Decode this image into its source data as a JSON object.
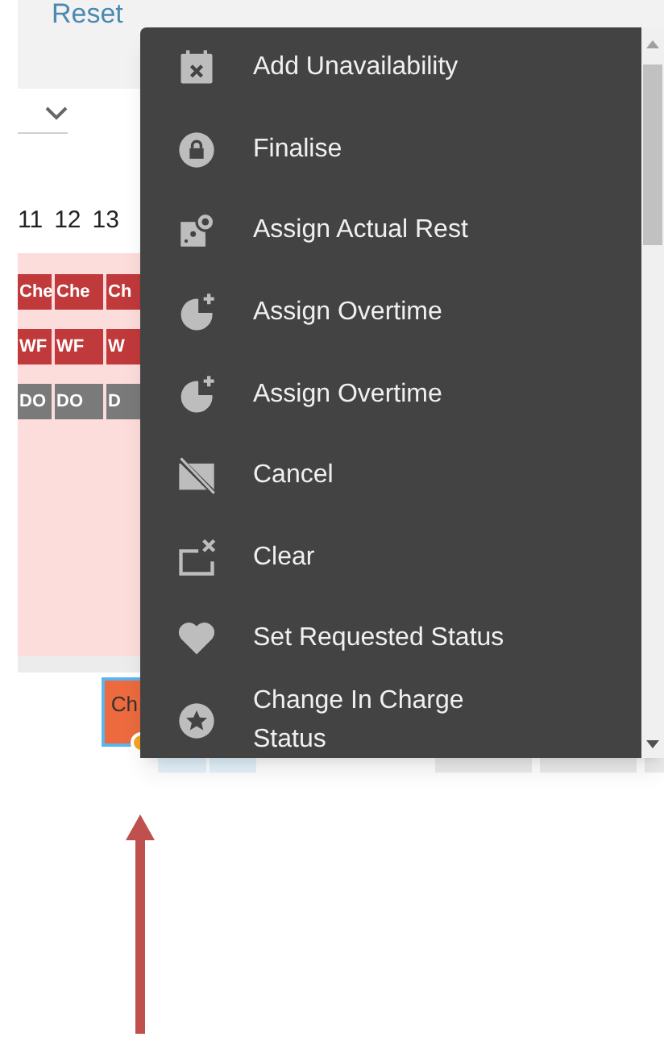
{
  "toolbar": {
    "reset_link": "Reset"
  },
  "day_numbers": [
    "11",
    "12",
    "13"
  ],
  "shift_rows": [
    {
      "color": "#c0393b",
      "chips": [
        "Che",
        "Che",
        "Ch"
      ]
    },
    {
      "color": "#c0393b",
      "chips": [
        "WF",
        "WF",
        "W"
      ]
    },
    {
      "color": "#7a7a7a",
      "chips": [
        "DO",
        "DO",
        "D"
      ]
    }
  ],
  "selected_shift": {
    "label": "Ch"
  },
  "context_menu": {
    "items": [
      {
        "label": "Add Unavailability"
      },
      {
        "label": "Finalise"
      },
      {
        "label": "Assign Actual Rest"
      },
      {
        "label": "Assign Overtime"
      },
      {
        "label": "Assign Overtime"
      },
      {
        "label": "Cancel"
      },
      {
        "label": "Clear"
      },
      {
        "label": "Set Requested Status"
      },
      {
        "label": "Change In Charge Status"
      }
    ]
  }
}
